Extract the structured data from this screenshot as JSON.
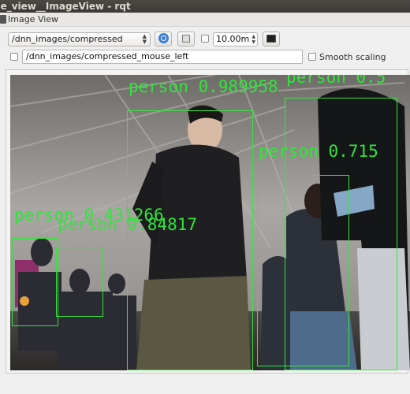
{
  "window": {
    "title": "ge_view__ImageView - rqt"
  },
  "dock": {
    "title": "Image View"
  },
  "toolbar": {
    "topic_value": "/dnn_images/compressed",
    "refresh_icon": "refresh-icon",
    "save_icon": "save-icon",
    "rate_value": "10.00m",
    "monitor_icon": "monitor-icon"
  },
  "mouse_topic": {
    "value": "/dnn_images/compressed_mouse_left"
  },
  "smooth_scaling": {
    "label": "Smooth scaling",
    "checked": false
  },
  "detections": [
    {
      "label": "person 0.989958"
    },
    {
      "label": "person 0.5"
    },
    {
      "label": "person 0.715"
    },
    {
      "label": "person 0.431266"
    },
    {
      "label": "person 0.84817"
    }
  ],
  "colors": {
    "detection": "#2fe63a",
    "titlebar": "#3b3a36",
    "accent": "#3a7ed0"
  }
}
